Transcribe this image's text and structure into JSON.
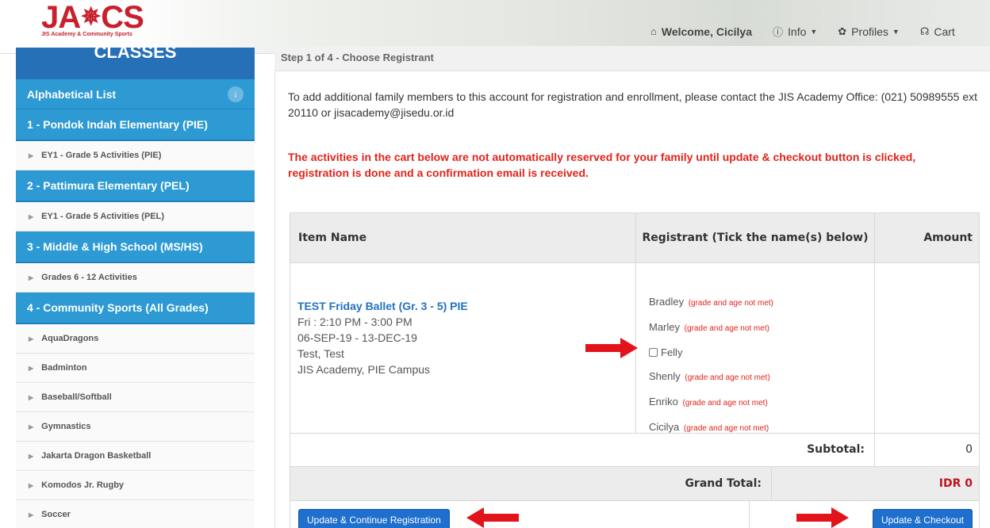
{
  "header": {
    "logo_main_left": "JA",
    "logo_main_right": "CS",
    "logo_sub": "JIS Academy & Community Sports",
    "nav": [
      {
        "icon": "home-icon",
        "glyph": "⌂",
        "label": "Welcome, Cicilya"
      },
      {
        "icon": "info-icon",
        "glyph": "ℹ",
        "label": "Info"
      },
      {
        "icon": "gear-icon",
        "glyph": "✿",
        "label": "Profiles"
      },
      {
        "icon": "cart-icon",
        "glyph": "🛒",
        "label": "Cart"
      }
    ]
  },
  "sidebar": {
    "classes_title": "CLASSES",
    "alpha_label": "Alphabetical List",
    "sections": [
      {
        "title": "1 - Pondok Indah Elementary (PIE)",
        "items": [
          "EY1 - Grade 5 Activities (PIE)"
        ]
      },
      {
        "title": "2 - Pattimura Elementary (PEL)",
        "items": [
          "EY1 - Grade 5 Activities (PEL)"
        ]
      },
      {
        "title": "3 - Middle & High School (MS/HS)",
        "items": [
          "Grades 6 - 12 Activities"
        ]
      },
      {
        "title": "4 - Community Sports (All Grades)",
        "items": [
          "AquaDragons",
          "Badminton",
          "Baseball/Softball",
          "Gymnastics",
          "Jakarta Dragon Basketball",
          "Komodos Jr. Rugby",
          "Soccer"
        ]
      }
    ]
  },
  "main": {
    "step": "Step 1 of 4 - Choose Registrant",
    "info": "To add additional family members to this account for registration and enrollment, please contact the JIS Academy Office: (021) 50989555 ext 20110 or jisacademy@jisedu.or.id",
    "warning": "The activities in the cart below are not automatically reserved for your family until update & checkout button is clicked, registration is done and a confirmation email is received.",
    "table": {
      "col_item": "Item Name",
      "col_registrant": "Registrant (Tick the name(s) below)",
      "col_amount": "Amount",
      "item": {
        "title": "TEST Friday Ballet (Gr. 3 - 5) PIE",
        "time": "Fri : 2:10 PM - 3:00 PM",
        "dates": "06-SEP-19 - 13-DEC-19",
        "instructor": "Test, Test",
        "location": "JIS Academy, PIE Campus"
      },
      "registrants": [
        {
          "name": "Bradley",
          "note": "(grade and age not met)"
        },
        {
          "name": "Marley",
          "note": "(grade and age not met)"
        },
        {
          "name": "Felly",
          "note": ""
        },
        {
          "name": "Shenly",
          "note": "(grade and age not met)"
        },
        {
          "name": "Enriko",
          "note": "(grade and age not met)"
        },
        {
          "name": "Cicilya",
          "note": "(grade and age not met)"
        }
      ],
      "subtotal_label": "Subtotal:",
      "subtotal_value": "0",
      "grand_label": "Grand Total:",
      "grand_value": "IDR 0",
      "btn_continue": "Update & Continue Registration",
      "btn_checkout": "Update & Checkout"
    }
  },
  "colors": {
    "brand_red": "#c8202c",
    "sidebar_blue": "#2d9ad4",
    "button_blue": "#1e6fce",
    "warning_red": "#e2231a",
    "arrow_red": "#e3131b"
  }
}
